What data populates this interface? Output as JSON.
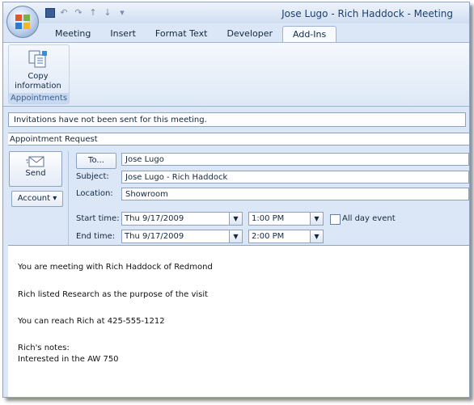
{
  "window": {
    "title": "Jose Lugo - Rich Haddock - Meeting"
  },
  "tabs": [
    {
      "label": "Meeting",
      "active": false
    },
    {
      "label": "Insert",
      "active": false
    },
    {
      "label": "Format Text",
      "active": false
    },
    {
      "label": "Developer",
      "active": false
    },
    {
      "label": "Add-Ins",
      "active": true
    }
  ],
  "ribbon": {
    "button_label_line1": "Copy",
    "button_label_line2": "information",
    "group_label": "Appointments"
  },
  "infobar": {
    "text": "Invitations have not been sent for this meeting."
  },
  "appointment": {
    "label": "Appointment Request"
  },
  "form": {
    "send_label": "Send",
    "account_label": "Account",
    "to_button": "To...",
    "to_value": "Jose Lugo",
    "subject_label": "Subject:",
    "subject_value": "Jose Lugo - Rich Haddock",
    "location_label": "Location:",
    "location_value": "Showroom",
    "start_label": "Start time:",
    "start_date": "Thu 9/17/2009",
    "start_time": "1:00 PM",
    "end_label": "End time:",
    "end_date": "Thu 9/17/2009",
    "end_time": "2:00 PM",
    "all_day_label": "All day event",
    "all_day_checked": false
  },
  "body": {
    "line1": "You are meeting with Rich Haddock of Redmond",
    "line2": "Rich listed Research as the purpose of the visit",
    "line3": "You can reach Rich at 425-555-1212",
    "line4": "Rich's notes:",
    "line5": "Interested in the AW 750"
  },
  "icons": [
    "office-logo-icon",
    "save-icon",
    "undo-icon",
    "redo-icon",
    "up-arrow-icon",
    "down-arrow-icon",
    "customize-icon",
    "copy-information-icon",
    "send-envelope-icon",
    "dropdown-arrow-icon"
  ]
}
